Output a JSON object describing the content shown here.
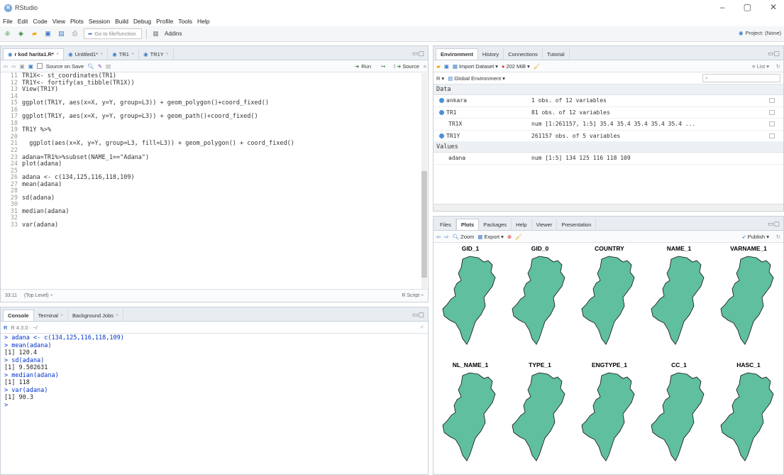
{
  "window": {
    "title": "RStudio"
  },
  "menu": [
    "File",
    "Edit",
    "Code",
    "View",
    "Plots",
    "Session",
    "Build",
    "Debug",
    "Profile",
    "Tools",
    "Help"
  ],
  "toolbar": {
    "goto_placeholder": "Go to file/function",
    "addins": "Addins",
    "project": "Project: (None)"
  },
  "editor": {
    "tabs": [
      {
        "label": "r kod harita1.R*",
        "active": true
      },
      {
        "label": "Untitled1*",
        "active": false
      },
      {
        "label": "TR1",
        "active": false
      },
      {
        "label": "TR1Y",
        "active": false
      }
    ],
    "source_on_save": "Source on Save",
    "run": "Run",
    "source": "Source",
    "lines": [
      {
        "n": "11",
        "code": "TR1X<- st_coordinates(TR1)"
      },
      {
        "n": "12",
        "code": "TR1Y<- fortify(as_tibble(TR1X))"
      },
      {
        "n": "13",
        "code": "View(TR1Y)"
      },
      {
        "n": "14",
        "code": ""
      },
      {
        "n": "15",
        "code": "ggplot(TR1Y, aes(x=X, y=Y, group=L3)) + geom_polygon()+coord_fixed()"
      },
      {
        "n": "16",
        "code": ""
      },
      {
        "n": "17",
        "code": "ggplot(TR1Y, aes(x=X, y=Y, group=L3)) + geom_path()+coord_fixed()"
      },
      {
        "n": "18",
        "code": ""
      },
      {
        "n": "19",
        "code": "TR1Y %>%"
      },
      {
        "n": "20",
        "code": ""
      },
      {
        "n": "21",
        "code": "  ggplot(aes(x=X, y=Y, group=L3, fill=L3)) + geom_polygon() + coord_fixed()"
      },
      {
        "n": "22",
        "code": ""
      },
      {
        "n": "23",
        "code": "adana=TR1%>%subset(NAME_1==\"Adana\")"
      },
      {
        "n": "24",
        "code": "plot(adana)"
      },
      {
        "n": "25",
        "code": ""
      },
      {
        "n": "26",
        "code": "adana <- c(134,125,116,118,109)"
      },
      {
        "n": "27",
        "code": "mean(adana)"
      },
      {
        "n": "28",
        "code": ""
      },
      {
        "n": "29",
        "code": "sd(adana)"
      },
      {
        "n": "30",
        "code": ""
      },
      {
        "n": "31",
        "code": "median(adana)"
      },
      {
        "n": "32",
        "code": ""
      },
      {
        "n": "33",
        "code": "var(adana)"
      }
    ],
    "status_pos": "33:11",
    "status_level": "(Top Level) ÷",
    "status_type": "R Script ÷"
  },
  "console": {
    "tabs": [
      {
        "label": "Console",
        "active": true
      },
      {
        "label": "Terminal",
        "active": false
      },
      {
        "label": "Background Jobs",
        "active": false
      }
    ],
    "version": "R 4.3.0 · ~/",
    "lines": [
      {
        "type": "in",
        "text": "> adana <- c(134,125,116,118,109)"
      },
      {
        "type": "in",
        "text": "> mean(adana)"
      },
      {
        "type": "out",
        "text": "[1] 120.4"
      },
      {
        "type": "in",
        "text": "> sd(adana)"
      },
      {
        "type": "out",
        "text": "[1] 9.502631"
      },
      {
        "type": "in",
        "text": "> median(adana)"
      },
      {
        "type": "out",
        "text": "[1] 118"
      },
      {
        "type": "in",
        "text": "> var(adana)"
      },
      {
        "type": "out",
        "text": "[1] 90.3"
      },
      {
        "type": "in",
        "text": "> "
      }
    ]
  },
  "environment": {
    "tabs": [
      {
        "label": "Environment",
        "active": true
      },
      {
        "label": "History",
        "active": false
      },
      {
        "label": "Connections",
        "active": false
      },
      {
        "label": "Tutorial",
        "active": false
      }
    ],
    "import_dataset": "Import Dataset",
    "memory": "202 MiB",
    "list_view": "List",
    "r_select": "R",
    "global_env": "Global Environment",
    "data_header": "Data",
    "data": [
      {
        "name": "ankara",
        "value": "1 obs. of 12 variables",
        "dot": true
      },
      {
        "name": "TR1",
        "value": "81 obs. of 12 variables",
        "dot": true
      },
      {
        "name": "TR1X",
        "value": "num [1:261157, 1:5] 35.4 35.4 35.4 35.4 35.4 ...",
        "dot": false
      },
      {
        "name": "TR1Y",
        "value": "261157 obs. of 5 variables",
        "dot": true
      }
    ],
    "values_header": "Values",
    "values": [
      {
        "name": "adana",
        "value": "num [1:5] 134 125 116 118 109"
      }
    ]
  },
  "files": {
    "tabs": [
      {
        "label": "Files",
        "active": false
      },
      {
        "label": "Plots",
        "active": true
      },
      {
        "label": "Packages",
        "active": false
      },
      {
        "label": "Help",
        "active": false
      },
      {
        "label": "Viewer",
        "active": false
      },
      {
        "label": "Presentation",
        "active": false
      }
    ],
    "zoom": "Zoom",
    "export": "Export",
    "publish": "Publish",
    "plot_titles": [
      "GID_1",
      "GID_0",
      "COUNTRY",
      "NAME_1",
      "VARNAME_1",
      "NL_NAME_1",
      "TYPE_1",
      "ENGTYPE_1",
      "CC_1",
      "HASC_1"
    ],
    "fill_color": "#5fbf9f"
  }
}
